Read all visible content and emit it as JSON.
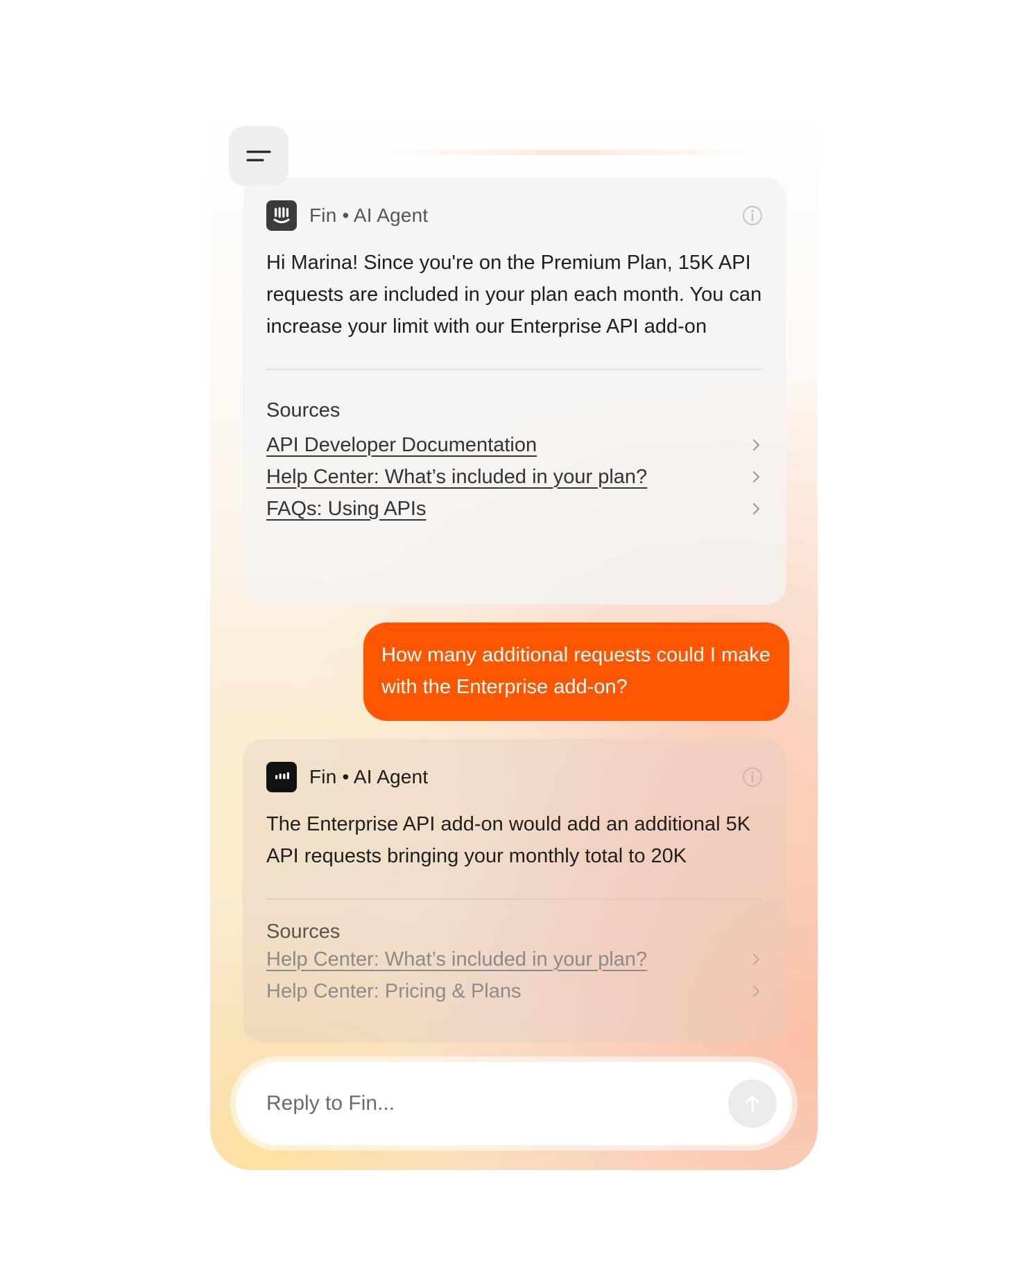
{
  "header": {
    "menu_icon": "menu-icon"
  },
  "messages": [
    {
      "type": "agent",
      "agent_name": "Fin • AI Agent",
      "avatar_icon": "fin-logo-icon",
      "info_icon": "info-icon",
      "text": "Hi Marina! Since you're on the Premium Plan, 15K API requests are included in your plan each month. You can increase your limit with our Enterprise API add-on",
      "sources_title": "Sources",
      "sources": [
        {
          "label": "API Developer Documentation"
        },
        {
          "label": "Help Center: What’s included in your plan?"
        },
        {
          "label": "FAQs: Using APIs"
        }
      ]
    },
    {
      "type": "user",
      "text": "How many additional requests could I make with the Enterprise add-on?"
    },
    {
      "type": "agent",
      "agent_name": "Fin • AI Agent",
      "avatar_icon": "fin-logo-icon",
      "info_icon": "info-icon",
      "text": "The Enterprise API add-on would add an additional 5K API requests bringing your monthly total to 20K",
      "sources_title": "Sources",
      "sources": [
        {
          "label": "Help Center: What’s included in your plan?"
        },
        {
          "label": "Help Center: Pricing & Plans"
        }
      ]
    }
  ],
  "composer": {
    "placeholder": "Reply to Fin...",
    "send_icon": "arrow-up-icon"
  },
  "colors": {
    "accent": "#ff5600",
    "user_bubble_text": "#ffffff"
  }
}
